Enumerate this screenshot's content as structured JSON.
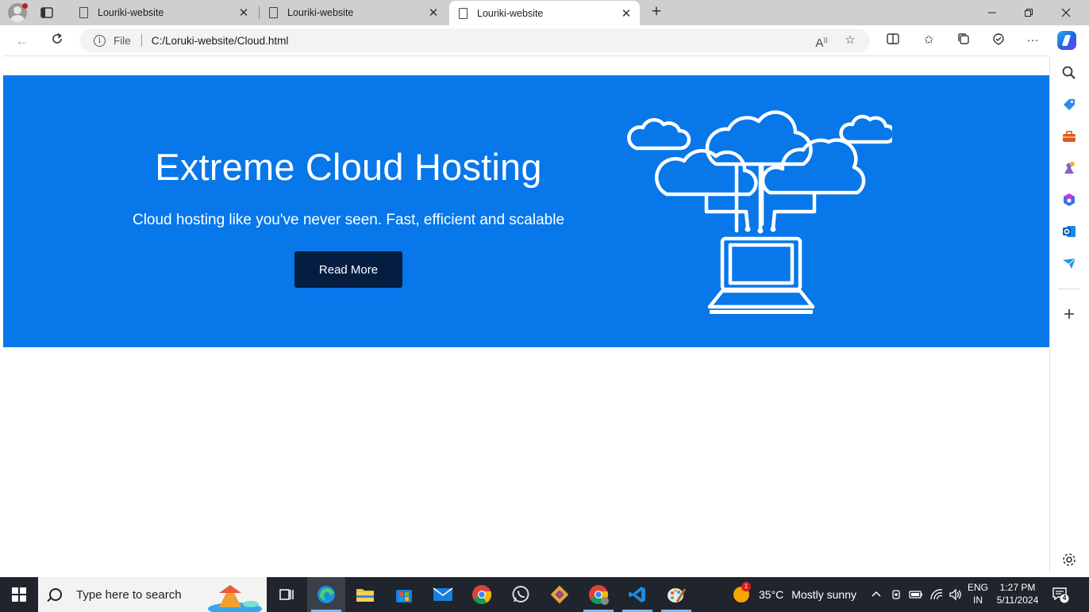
{
  "browser": {
    "tabs": [
      {
        "title": "Louriki-website",
        "active": false
      },
      {
        "title": "Louriki-website",
        "active": false
      },
      {
        "title": "Louriki-website",
        "active": true
      }
    ],
    "address": {
      "scheme_label": "File",
      "url": "C:/Loruki-website/Cloud.html"
    },
    "window_controls": [
      "minimize",
      "restore",
      "close"
    ]
  },
  "page": {
    "hero": {
      "title": "Extreme Cloud Hosting",
      "subtitle": "Cloud hosting like you've never seen. Fast, efficient and scalable",
      "button_label": "Read More",
      "background_color": "#0777ea",
      "button_color": "#061d42"
    }
  },
  "sidebar": {
    "icons": [
      "search-icon",
      "tag-icon",
      "toolbox-icon",
      "games-icon",
      "microsoft365-icon",
      "outlook-icon",
      "send-icon",
      "add-icon",
      "settings-icon"
    ]
  },
  "taskbar": {
    "search_placeholder": "Type here to search",
    "apps": [
      "task-view",
      "edge",
      "file-explorer",
      "microsoft-store",
      "mail",
      "chrome",
      "whatsapp",
      "git",
      "chrome-profile",
      "vscode",
      "paint"
    ],
    "weather": {
      "temperature": "35°C",
      "condition": "Mostly sunny",
      "badge": "1"
    },
    "language": {
      "line1": "ENG",
      "line2": "IN"
    },
    "clock": {
      "time": "1:27 PM",
      "date": "5/11/2024"
    },
    "notification_count": "4"
  }
}
